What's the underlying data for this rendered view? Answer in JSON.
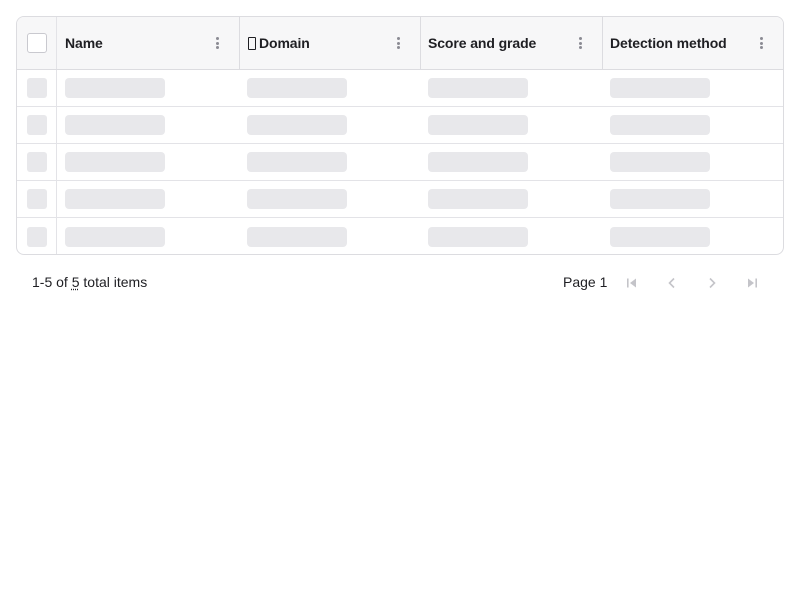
{
  "table": {
    "columns": [
      {
        "label": "Name"
      },
      {
        "label": "Domain"
      },
      {
        "label": "Score and grade"
      },
      {
        "label": "Detection method"
      }
    ],
    "row_count_loading": 5
  },
  "footer": {
    "range": "1-5",
    "of_text": "of",
    "total": "5",
    "total_suffix": "total items",
    "page_label": "Page 1"
  },
  "icons": {
    "header_select_all": "checkbox",
    "domain_column": "lock-icon",
    "column_menu": "more-vertical-icon",
    "first_page": "first-page-icon",
    "prev_page": "chevron-left-icon",
    "next_page": "chevron-right-icon",
    "last_page": "last-page-icon"
  },
  "colors": {
    "border": "#dcdce0",
    "header_bg": "#f7f7f8",
    "skeleton": "#e8e8eb",
    "text": "#1f1f23",
    "disabled_icon": "#c4c4c9"
  }
}
